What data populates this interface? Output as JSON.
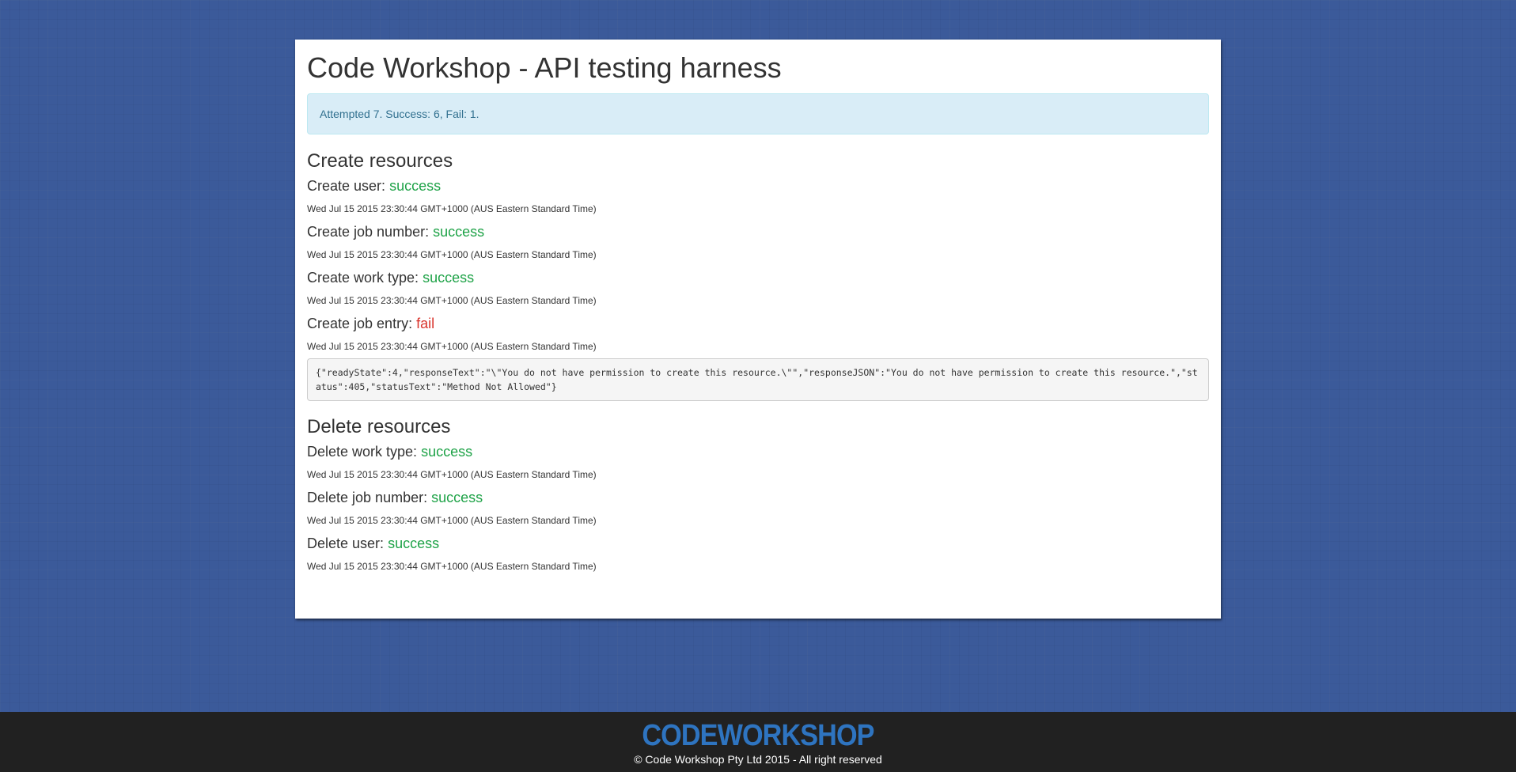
{
  "page": {
    "title": "Code Workshop - API testing harness",
    "summary": "Attempted 7. Success: 6, Fail: 1."
  },
  "sections": [
    {
      "heading": "Create resources",
      "items": [
        {
          "label": "Create user:",
          "status": "success",
          "timestamp": "Wed Jul 15 2015 23:30:44 GMT+1000 (AUS Eastern Standard Time)"
        },
        {
          "label": "Create job number:",
          "status": "success",
          "timestamp": "Wed Jul 15 2015 23:30:44 GMT+1000 (AUS Eastern Standard Time)"
        },
        {
          "label": "Create work type:",
          "status": "success",
          "timestamp": "Wed Jul 15 2015 23:30:44 GMT+1000 (AUS Eastern Standard Time)"
        },
        {
          "label": "Create job entry:",
          "status": "fail",
          "timestamp": "Wed Jul 15 2015 23:30:44 GMT+1000 (AUS Eastern Standard Time)",
          "error": "{\"readyState\":4,\"responseText\":\"\\\"You do not have permission to create this resource.\\\"\",\"responseJSON\":\"You do not have permission to create this resource.\",\"status\":405,\"statusText\":\"Method Not Allowed\"}"
        }
      ]
    },
    {
      "heading": "Delete resources",
      "items": [
        {
          "label": "Delete work type:",
          "status": "success",
          "timestamp": "Wed Jul 15 2015 23:30:44 GMT+1000 (AUS Eastern Standard Time)"
        },
        {
          "label": "Delete job number:",
          "status": "success",
          "timestamp": "Wed Jul 15 2015 23:30:44 GMT+1000 (AUS Eastern Standard Time)"
        },
        {
          "label": "Delete user:",
          "status": "success",
          "timestamp": "Wed Jul 15 2015 23:30:44 GMT+1000 (AUS Eastern Standard Time)"
        }
      ]
    }
  ],
  "footer": {
    "logo": "CODEWORKSHOP",
    "copyright": "© Code Workshop Pty Ltd 2015 - All right reserved"
  },
  "colors": {
    "success": "#1fa348",
    "fail": "#d9342c",
    "background": "#3b5a9a",
    "logo": "#2e74c0"
  }
}
